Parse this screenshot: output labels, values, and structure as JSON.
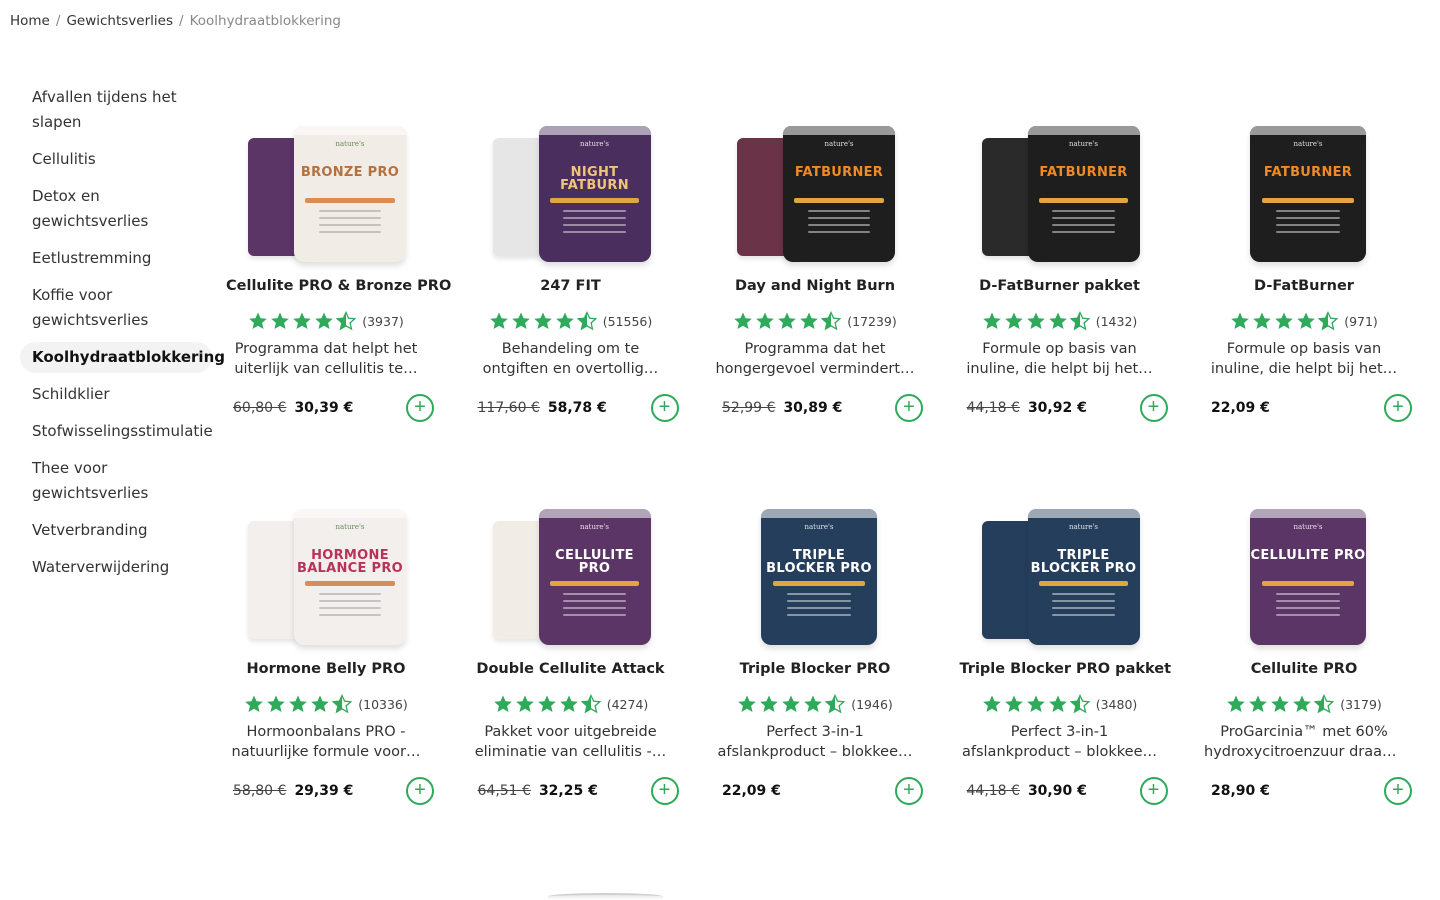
{
  "breadcrumb": {
    "home": "Home",
    "category": "Gewichtsverlies",
    "current": "Koolhydraatblokkering"
  },
  "sidebar": {
    "items": [
      {
        "label_line1": "Afvallen tijdens het",
        "label_line2": "slapen",
        "active": false
      },
      {
        "label_line1": "Cellulitis",
        "label_line2": "",
        "active": false
      },
      {
        "label_line1": "Detox en",
        "label_line2": "gewichtsverlies",
        "active": false
      },
      {
        "label_line1": "Eetlustremming",
        "label_line2": "",
        "active": false
      },
      {
        "label_line1": "Koffie voor",
        "label_line2": "gewichtsverlies",
        "active": false
      },
      {
        "label_line1": "Koolhydraatblokkering",
        "label_line2": "",
        "active": true
      },
      {
        "label_line1": "Schildklier",
        "label_line2": "",
        "active": false
      },
      {
        "label_line1": "Stofwisselingsstimulatie",
        "label_line2": "",
        "active": false
      },
      {
        "label_line1": "Thee voor",
        "label_line2": "gewichtsverlies",
        "active": false
      },
      {
        "label_line1": "Vetverbranding",
        "label_line2": "",
        "active": false
      },
      {
        "label_line1": "Waterverwijdering",
        "label_line2": "",
        "active": false
      }
    ]
  },
  "colors": {
    "accent_green": "#2eaa5a",
    "star_green": "#2eaa5a",
    "active_bg": "#f3f3f3"
  },
  "products": [
    {
      "name": "Cellulite PRO & Bronze PRO",
      "rating": 4.5,
      "reviews": "(3937)",
      "desc1": "Programma dat helpt het",
      "desc2": "uiterlijk van cellulitis te…",
      "old_price": "60,80 €",
      "price": "30,39 €",
      "can_text": "BRONZE PRO",
      "can_color": "#f1ede6",
      "can_text_color": "#b5713d",
      "back_color": "#5a3566",
      "can_logo": "nature's"
    },
    {
      "name": "247 FIT",
      "rating": 4.5,
      "reviews": "(51556)",
      "desc1": "Behandeling om te",
      "desc2": "ontgiften en overtollig…",
      "old_price": "117,60 €",
      "price": "58,78 €",
      "can_text": "NIGHT FATBURN",
      "can_color": "#4a2f5e",
      "can_text_color": "#f0c57a",
      "back_color": "#e6e6e6",
      "can_logo": "nature's"
    },
    {
      "name": "Day and Night Burn",
      "rating": 4.5,
      "reviews": "(17239)",
      "desc1": "Programma dat het",
      "desc2": "hongergevoel vermindert…",
      "old_price": "52,99 €",
      "price": "30,89 €",
      "can_text": "FATBURNER",
      "can_color": "#1e1e1e",
      "can_text_color": "#f08a24",
      "back_color": "#6b3348",
      "can_logo": "nature's"
    },
    {
      "name": "D-FatBurner pakket",
      "rating": 4.5,
      "reviews": "(1432)",
      "desc1": "Formule op basis van",
      "desc2": "inuline, die helpt bij het…",
      "old_price": "44,18 €",
      "price": "30,92 €",
      "can_text": "FATBURNER",
      "can_color": "#1e1e1e",
      "can_text_color": "#f08a24",
      "back_color": "#2a2a2a",
      "can_logo": "nature's"
    },
    {
      "name": "D-FatBurner",
      "rating": 4.5,
      "reviews": "(971)",
      "desc1": "Formule op basis van",
      "desc2": "inuline, die helpt bij het…",
      "old_price": "",
      "price": "22,09 €",
      "can_text": "FATBURNER",
      "can_color": "#1e1e1e",
      "can_text_color": "#f08a24",
      "back_color": "",
      "can_logo": "nature's"
    },
    {
      "name": "Hormone Belly PRO",
      "rating": 4.5,
      "reviews": "(10336)",
      "desc1": "Hormoonbalans PRO -",
      "desc2": "natuurlijke formule voor…",
      "old_price": "58,80 €",
      "price": "29,39 €",
      "can_text": "HORMONE BALANCE PRO",
      "can_color": "#f2efed",
      "can_text_color": "#b8325a",
      "back_color": "#f2efed",
      "can_logo": "nature's"
    },
    {
      "name": "Double Cellulite Attack",
      "rating": 4.5,
      "reviews": "(4274)",
      "desc1": "Pakket voor uitgebreide",
      "desc2": "eliminatie van cellulitis -…",
      "old_price": "64,51 €",
      "price": "32,25 €",
      "can_text": "CELLULITE PRO",
      "can_color": "#5a3566",
      "can_text_color": "#ffffff",
      "back_color": "#f1ede6",
      "can_logo": "nature's"
    },
    {
      "name": "Triple Blocker PRO",
      "rating": 4.5,
      "reviews": "(1946)",
      "desc1": "Perfect 3-in-1",
      "desc2": "afslankproduct – blokkee…",
      "old_price": "",
      "price": "22,09 €",
      "can_text": "TRIPLE BLOCKER PRO",
      "can_color": "#253e5c",
      "can_text_color": "#ffffff",
      "back_color": "",
      "can_logo": "nature's"
    },
    {
      "name": "Triple Blocker PRO pakket",
      "rating": 4.5,
      "reviews": "(3480)",
      "desc1": "Perfect 3-in-1",
      "desc2": "afslankproduct – blokkee…",
      "old_price": "44,18 €",
      "price": "30,90 €",
      "can_text": "TRIPLE BLOCKER PRO",
      "can_color": "#253e5c",
      "can_text_color": "#ffffff",
      "back_color": "#253e5c",
      "can_logo": "nature's"
    },
    {
      "name": "Cellulite PRO",
      "rating": 4.5,
      "reviews": "(3179)",
      "desc1": "ProGarcinia™ met 60%",
      "desc2": "hydroxycitroenzuur draag…",
      "old_price": "",
      "price": "28,90 €",
      "can_text": "CELLULITE PRO",
      "can_color": "#5a3566",
      "can_text_color": "#ffffff",
      "back_color": "",
      "can_logo": "nature's"
    }
  ]
}
